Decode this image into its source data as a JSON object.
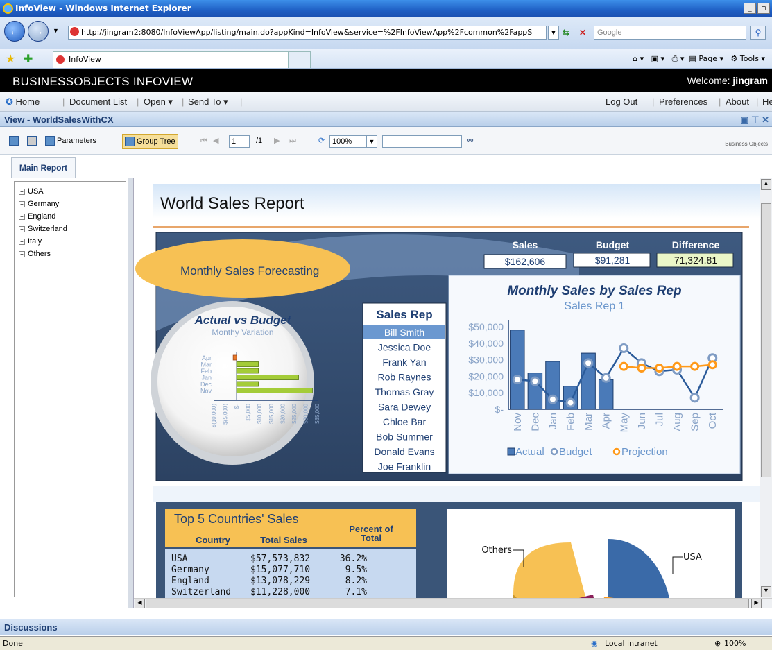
{
  "browser": {
    "title": "InfoView - Windows Internet Explorer",
    "url": "http://jingram2:8080/InfoViewApp/listing/main.do?appKind=InfoView&service=%2FInfoViewApp%2Fcommon%2FappS",
    "search_placeholder": "Google",
    "tab_label": "InfoView",
    "tools": {
      "page": "Page",
      "tools": "Tools"
    },
    "status": "Done",
    "zone": "Local intranet",
    "zoom": "100%"
  },
  "app": {
    "brand": "BUSINESSOBJECTS INFOVIEW",
    "welcome_label": "Welcome:",
    "welcome_user": "jingram",
    "menu": {
      "home": "Home",
      "doclist": "Document List",
      "open": "Open",
      "sendto": "Send To",
      "logout": "Log Out",
      "preferences": "Preferences",
      "about": "About",
      "help": "Help"
    },
    "view_title": "View - WorldSalesWithCX",
    "toolbar": {
      "parameters": "Parameters",
      "group_tree": "Group Tree",
      "page_num": "1",
      "page_total": "/1",
      "zoom": "100%",
      "logo": "Business Objects"
    },
    "tab": "Main Report",
    "tree": [
      "USA",
      "Germany",
      "England",
      "Switzerland",
      "Italy",
      "Others"
    ],
    "discussions": "Discussions"
  },
  "report": {
    "title": "World Sales Report",
    "forecast_label": "Monthly Sales Forecasting",
    "kpis": {
      "sales_label": "Sales",
      "sales_value": "$162,606",
      "budget_label": "Budget",
      "budget_value": "$91,281",
      "diff_label": "Difference",
      "diff_value": "71,324.81"
    },
    "salesrep_header": "Sales Rep",
    "sales_reps": [
      "Bill Smith",
      "Jessica Doe",
      "Frank Yan",
      "Rob Raynes",
      "Thomas Gray",
      "Sara Dewey",
      "Chloe Bar",
      "Bob Summer",
      "Donald Evans",
      "Joe Franklin"
    ],
    "top5": {
      "title": "Top 5 Countries' Sales",
      "col_country": "Country",
      "col_total": "Total Sales",
      "col_pct": "Percent of Total",
      "rows": [
        {
          "country": "USA",
          "total": "$57,573,832",
          "pct": "36.2%"
        },
        {
          "country": "Germany",
          "total": "$15,077,710",
          "pct": "9.5%"
        },
        {
          "country": "England",
          "total": "$13,078,229",
          "pct": "8.2%"
        },
        {
          "country": "Switzerland",
          "total": "$11,228,000",
          "pct": "7.1%"
        }
      ]
    }
  },
  "chart_data": [
    {
      "type": "bar",
      "title": "Actual vs Budget",
      "subtitle": "Monthy Variation",
      "categories": [
        "Apr",
        "Mar",
        "Feb",
        "Jan",
        "Dec",
        "Nov"
      ],
      "values": [
        -1500,
        9500,
        9500,
        27000,
        9500,
        33000
      ],
      "x_tick_labels": [
        "$(10,000)",
        "$(5,000)",
        "$-",
        "$5,000",
        "$10,000",
        "$15,000",
        "$20,000",
        "$25,000",
        "$30,000",
        "$35,000"
      ],
      "xlim": [
        -10000,
        35000
      ]
    },
    {
      "type": "bar",
      "title": "Monthly Sales by Sales Rep",
      "subtitle": "Sales Rep 1",
      "categories": [
        "Nov",
        "Dec",
        "Jan",
        "Feb",
        "Mar",
        "Apr",
        "May",
        "Jun",
        "Jul",
        "Aug",
        "Sep",
        "Oct"
      ],
      "series": [
        {
          "name": "Actual",
          "values": [
            48000,
            22000,
            29000,
            14000,
            34000,
            18000,
            null,
            null,
            null,
            null,
            null,
            null
          ]
        },
        {
          "name": "Budget",
          "values": [
            18000,
            17000,
            6000,
            4000,
            28000,
            19000,
            37000,
            28000,
            23000,
            24000,
            7000,
            31000
          ]
        },
        {
          "name": "Projection",
          "values": [
            null,
            null,
            null,
            null,
            null,
            null,
            26000,
            25000,
            25000,
            26000,
            26000,
            27000
          ]
        }
      ],
      "y_tick_labels": [
        "$50,000",
        "$40,000",
        "$30,000",
        "$20,000",
        "$10,000",
        "$-"
      ],
      "ylim": [
        0,
        50000
      ]
    },
    {
      "type": "pie",
      "labels": [
        "USA",
        "Others"
      ],
      "values": [
        36.2,
        39.5
      ]
    }
  ]
}
